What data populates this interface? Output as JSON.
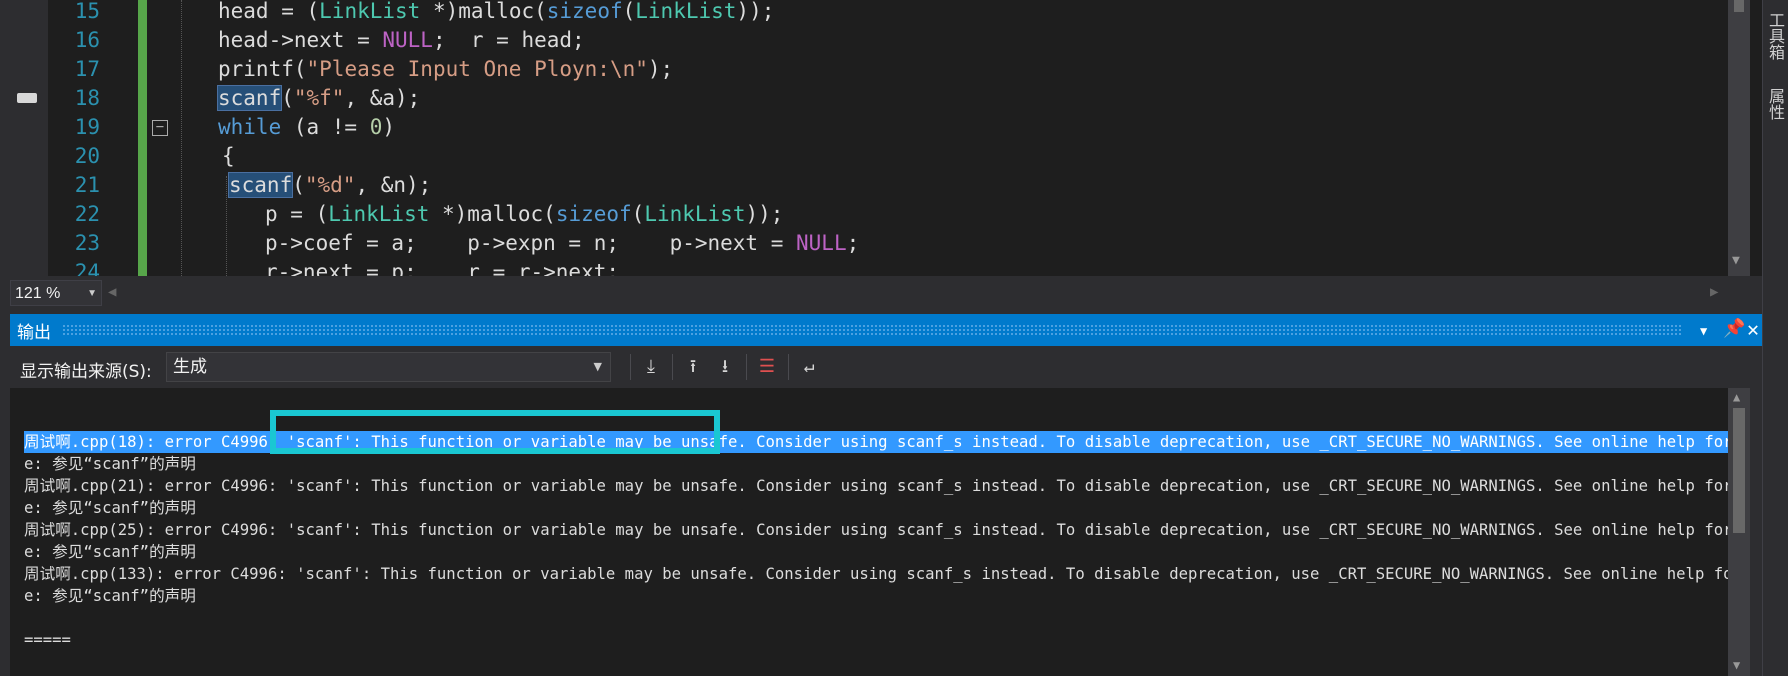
{
  "editor": {
    "lines": [
      {
        "num": "15",
        "code": "head = (LinkList *)malloc(sizeof(LinkList));"
      },
      {
        "num": "16",
        "code": "head->next = NULL;  r = head;"
      },
      {
        "num": "17",
        "code": "printf(\"Please Input One Ployn:\\n\");"
      },
      {
        "num": "18",
        "code": "scanf(\"%f\", &a);"
      },
      {
        "num": "19",
        "code": "while (a != 0)"
      },
      {
        "num": "20",
        "code": "{"
      },
      {
        "num": "21",
        "code": "scanf(\"%d\", &n);"
      },
      {
        "num": "22",
        "code": "p = (LinkList *)malloc(sizeof(LinkList));"
      },
      {
        "num": "23",
        "code": "p->coef = a;    p->expn = n;    p->next = NULL;"
      },
      {
        "num": "24",
        "code": "r->next = p;    r = r->next;"
      }
    ],
    "zoom": "121 %"
  },
  "right_dock": {
    "toolbox": "工具箱",
    "properties": "属性"
  },
  "output": {
    "title": "输出",
    "source_label": "显示输出来源(S):",
    "source_value": "生成",
    "toolbar_icons": [
      "goto-current-icon",
      "prev-message-icon",
      "next-message-icon",
      "clear-all-icon",
      "word-wrap-icon"
    ],
    "lines": [
      "周试啊.cpp(18): error C4996: 'scanf': This function or variable may be unsafe. Consider using scanf_s instead. To disable deprecation, use _CRT_SECURE_NO_WARNINGS. See online help for detail",
      "e: 参见“scanf”的声明",
      "周试啊.cpp(21): error C4996: 'scanf': This function or variable may be unsafe. Consider using scanf_s instead. To disable deprecation, use _CRT_SECURE_NO_WARNINGS. See online help for detail",
      "e: 参见“scanf”的声明",
      "周试啊.cpp(25): error C4996: 'scanf': This function or variable may be unsafe. Consider using scanf_s instead. To disable deprecation, use _CRT_SECURE_NO_WARNINGS. See online help for detail",
      "e: 参见“scanf”的声明",
      "周试啊.cpp(133): error C4996: 'scanf': This function or variable may be unsafe. Consider using scanf_s instead. To disable deprecation, use _CRT_SECURE_NO_WARNINGS. See online help for detai",
      "e: 参见“scanf”的声明",
      "",
      "====="
    ],
    "selected_line_index": 0
  },
  "colors": {
    "accent": "#007acc",
    "selection": "#3399ff",
    "annotation_box": "#1ac7d2",
    "change_bar": "#57a64a"
  }
}
